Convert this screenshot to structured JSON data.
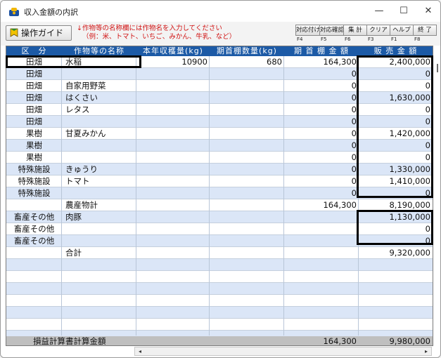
{
  "window": {
    "title": "収入金額の内訳",
    "minimize": "—",
    "maximize": "☐",
    "close": "✕"
  },
  "toolbar": {
    "guide_label": "操作ガイド",
    "note_line1": "↓作物等の名称欄には作物名を入力してください",
    "note_line2": "（例：米、トマト、いちご、みかん、牛乳、など）",
    "buttons": [
      {
        "label": "対応付け",
        "key": "F4"
      },
      {
        "label": "対応確認",
        "key": "F5"
      },
      {
        "label": "集 計",
        "key": "F6"
      },
      {
        "label": "クリア",
        "key": "F3"
      },
      {
        "label": "ヘルプ",
        "key": "F1"
      },
      {
        "label": "終 了",
        "key": "F8"
      }
    ]
  },
  "table": {
    "headers": [
      "区　分",
      "作物等の名称",
      "本年収穫量(kg)",
      "期首棚数量(kg)",
      "期 首 棚 金 額",
      "販 売 金 額"
    ],
    "rows": [
      {
        "kubun": "田畑",
        "name": "水稲",
        "harvest": "10900",
        "begin_qty": "680",
        "begin_amt": "164,300",
        "sales": "2,400,000"
      },
      {
        "kubun": "田畑",
        "name": "",
        "harvest": "",
        "begin_qty": "",
        "begin_amt": "0",
        "sales": "0"
      },
      {
        "kubun": "田畑",
        "name": "自家用野菜",
        "harvest": "",
        "begin_qty": "",
        "begin_amt": "0",
        "sales": "0"
      },
      {
        "kubun": "田畑",
        "name": "はくさい",
        "harvest": "",
        "begin_qty": "",
        "begin_amt": "0",
        "sales": "1,630,000"
      },
      {
        "kubun": "田畑",
        "name": "レタス",
        "harvest": "",
        "begin_qty": "",
        "begin_amt": "0",
        "sales": "0"
      },
      {
        "kubun": "田畑",
        "name": "",
        "harvest": "",
        "begin_qty": "",
        "begin_amt": "0",
        "sales": "0"
      },
      {
        "kubun": "果樹",
        "name": "甘夏みかん",
        "harvest": "",
        "begin_qty": "",
        "begin_amt": "0",
        "sales": "1,420,000"
      },
      {
        "kubun": "果樹",
        "name": "",
        "harvest": "",
        "begin_qty": "",
        "begin_amt": "0",
        "sales": "0"
      },
      {
        "kubun": "果樹",
        "name": "",
        "harvest": "",
        "begin_qty": "",
        "begin_amt": "0",
        "sales": "0"
      },
      {
        "kubun": "特殊施設",
        "name": "きゅうり",
        "harvest": "",
        "begin_qty": "",
        "begin_amt": "0",
        "sales": "1,330,000"
      },
      {
        "kubun": "特殊施設",
        "name": "トマト",
        "harvest": "",
        "begin_qty": "",
        "begin_amt": "0",
        "sales": "1,410,000"
      },
      {
        "kubun": "特殊施設",
        "name": "",
        "harvest": "",
        "begin_qty": "",
        "begin_amt": "0",
        "sales": "0"
      },
      {
        "kubun": "",
        "name": "農産物計",
        "harvest": "",
        "begin_qty": "",
        "begin_amt": "164,300",
        "sales": "8,190,000"
      },
      {
        "kubun": "畜産その他",
        "name": "肉豚",
        "harvest": "",
        "begin_qty": "",
        "begin_amt": "",
        "sales": "1,130,000"
      },
      {
        "kubun": "畜産その他",
        "name": "",
        "harvest": "",
        "begin_qty": "",
        "begin_amt": "",
        "sales": "0"
      },
      {
        "kubun": "畜産その他",
        "name": "",
        "harvest": "",
        "begin_qty": "",
        "begin_amt": "",
        "sales": "0"
      },
      {
        "kubun": "",
        "name": "合計",
        "harvest": "",
        "begin_qty": "",
        "begin_amt": "",
        "sales": "9,320,000"
      },
      {
        "kubun": "",
        "name": "",
        "harvest": "",
        "begin_qty": "",
        "begin_amt": "",
        "sales": ""
      },
      {
        "kubun": "",
        "name": "",
        "harvest": "",
        "begin_qty": "",
        "begin_amt": "",
        "sales": ""
      },
      {
        "kubun": "",
        "name": "",
        "harvest": "",
        "begin_qty": "",
        "begin_amt": "",
        "sales": ""
      },
      {
        "kubun": "",
        "name": "",
        "harvest": "",
        "begin_qty": "",
        "begin_amt": "",
        "sales": ""
      },
      {
        "kubun": "",
        "name": "",
        "harvest": "",
        "begin_qty": "",
        "begin_amt": "",
        "sales": ""
      },
      {
        "kubun": "",
        "name": "",
        "harvest": "",
        "begin_qty": "",
        "begin_amt": "",
        "sales": ""
      },
      {
        "kubun": "",
        "name": "",
        "harvest": "",
        "begin_qty": "",
        "begin_amt": "",
        "sales": ""
      }
    ],
    "footer": {
      "label": "損益計算書計算金額",
      "begin_amt": "164,300",
      "sales": "9,980,000"
    }
  },
  "colors": {
    "header_bg": "#1c5aa6",
    "row_alt": "#dbe6f7",
    "note_red": "#d01010",
    "footer_bg": "#bfbfbf"
  },
  "icons": {
    "app": "money-bag-icon",
    "guide": "guide-arrow-icon",
    "scroll_left": "◂",
    "scroll_right": "▸"
  }
}
